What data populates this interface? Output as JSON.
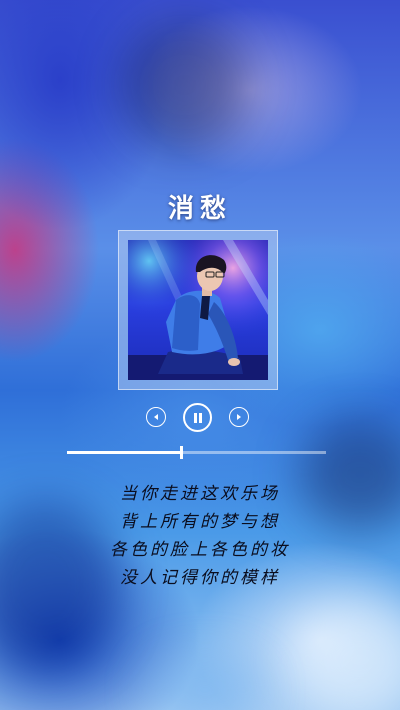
{
  "song": {
    "title": "消愁"
  },
  "player": {
    "progress_fraction": 0.44,
    "controls": {
      "prev_icon": "previous-track-icon",
      "play_pause_icon": "pause-icon",
      "next_icon": "next-track-icon"
    }
  },
  "lyrics": [
    "当你走进这欢乐场",
    "背上所有的梦与想",
    "各色的脸上各色的妆",
    "没人记得你的模样"
  ],
  "colors": {
    "accent": "#ffffff",
    "lyric_text": "#0a0d1e",
    "background_primary": "#3a6fd8"
  }
}
